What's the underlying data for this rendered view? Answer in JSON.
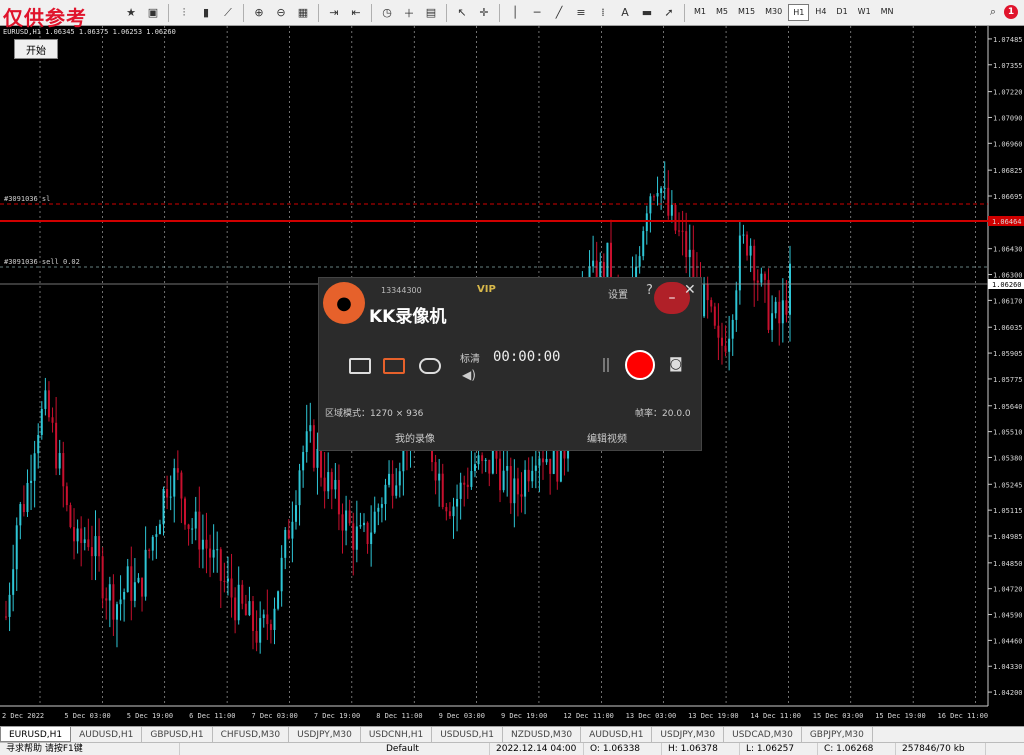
{
  "toolbar": {
    "watermark": "仅供参考",
    "timeframes": [
      "M1",
      "M5",
      "M15",
      "M30",
      "H1",
      "H4",
      "D1",
      "W1",
      "MN"
    ],
    "active_timeframe": "H1",
    "notification_count": "1"
  },
  "chart": {
    "symbol_info": "EURUSD,H1 1.06345 1.06375 1.06253 1.06260",
    "start_button": "开始",
    "order_labels": [
      "#3091036 sl",
      "#3091036 sell 0.02"
    ],
    "current_price": "1.06260",
    "red_line_price": "1.06464",
    "colors": {
      "bull": "#2ec6d6",
      "bear": "#c8102e",
      "order_line": "#d00000",
      "background": "#000000"
    }
  },
  "chart_data": {
    "type": "candlestick",
    "symbol": "EURUSD",
    "timeframe": "H1",
    "y_ticks": [
      "1.07485",
      "1.07355",
      "1.07220",
      "1.07090",
      "1.06960",
      "1.06825",
      "1.06695",
      "1.06430",
      "1.06300",
      "1.06170",
      "1.06035",
      "1.05905",
      "1.05775",
      "1.05640",
      "1.05510",
      "1.05380",
      "1.05245",
      "1.05115",
      "1.04985",
      "1.04850",
      "1.04720",
      "1.04590",
      "1.04460",
      "1.04330",
      "1.04200"
    ],
    "ylim": [
      1.0413,
      1.0755
    ],
    "x_ticks": [
      "2 Dec 2022",
      "5 Dec 03:00",
      "5 Dec 19:00",
      "6 Dec 11:00",
      "7 Dec 03:00",
      "7 Dec 19:00",
      "8 Dec 11:00",
      "9 Dec 03:00",
      "9 Dec 19:00",
      "12 Dec 11:00",
      "13 Dec 03:00",
      "13 Dec 19:00",
      "14 Dec 11:00",
      "15 Dec 03:00",
      "15 Dec 19:00",
      "16 Dec 11:00"
    ],
    "price_trace": [
      1.0458,
      1.0505,
      1.052,
      1.0555,
      1.0562,
      1.054,
      1.051,
      1.0492,
      1.05,
      1.0485,
      1.047,
      1.0465,
      1.0475,
      1.047,
      1.049,
      1.051,
      1.053,
      1.0525,
      1.0505,
      1.05,
      1.049,
      1.0478,
      1.047,
      1.0462,
      1.0455,
      1.0448,
      1.046,
      1.048,
      1.051,
      1.054,
      1.0545,
      1.0532,
      1.052,
      1.051,
      1.05,
      1.0495,
      1.0505,
      1.052,
      1.053,
      1.0545,
      1.056,
      1.0548,
      1.054,
      1.052,
      1.0515,
      1.0525,
      1.0535,
      1.053,
      1.054,
      1.0525,
      1.0518,
      1.053,
      1.0545,
      1.054,
      1.0535,
      1.0545,
      1.06,
      1.063,
      1.0625,
      1.0638,
      1.061,
      1.0595,
      1.064,
      1.067,
      1.068,
      1.066,
      1.065,
      1.064,
      1.062,
      1.061,
      1.059,
      1.0605,
      1.064,
      1.065,
      1.0625,
      1.061,
      1.0605,
      1.0626
    ]
  },
  "recorder": {
    "title": "KK录像机",
    "user": "13344300",
    "vip": "VIP",
    "settings": "设置",
    "help": "?",
    "quality": "标清",
    "timer": "00:00:00",
    "area": "区域模式：1270 × 936",
    "fps": "帧率：20.0.0",
    "my_videos": "我的录像",
    "edit_video": "编辑视频"
  },
  "tabs": [
    "EURUSD,H1",
    "AUDUSD,H1",
    "GBPUSD,H1",
    "CHFUSD,M30",
    "USDJPY,M30",
    "USDCNH,H1",
    "USDUSD,H1",
    "NZDUSD,M30",
    "AUDUSD,H1",
    "USDJPY,M30",
    "USDCAD,M30",
    "GBPJPY,M30"
  ],
  "status": {
    "help": "寻求帮助 请按F1键",
    "profile": "Default",
    "datetime": "2022.12.14 04:00",
    "open": "O: 1.06338",
    "high": "H: 1.06378",
    "low": "L: 1.06257",
    "close": "C: 1.06268",
    "traffic": "257846/70 kb"
  }
}
